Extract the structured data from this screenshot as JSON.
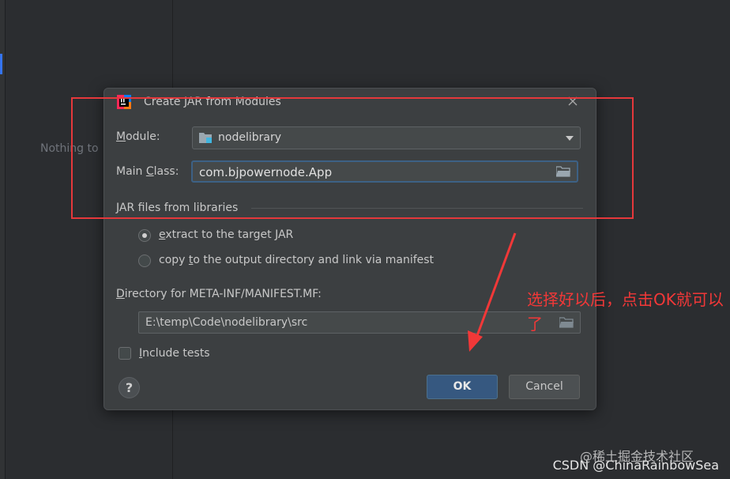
{
  "background": {
    "empty_text": "Nothing to"
  },
  "dialog": {
    "title": "Create JAR from Modules",
    "module_label_key": "M",
    "module_label_rest": "odule:",
    "module_value": "nodelibrary",
    "main_class_label_pre": "Main ",
    "main_class_label_key": "C",
    "main_class_label_post": "lass:",
    "main_class_value": "com.bjpowernode.App",
    "section_label": "JAR files from libraries",
    "radio_extract_key": "e",
    "radio_extract_rest": "xtract to the target JAR",
    "radio_copy_pre": "copy ",
    "radio_copy_key": "t",
    "radio_copy_rest": "o the output directory and link via manifest",
    "manifest_label_key": "D",
    "manifest_label_rest": "irectory for META-INF/MANIFEST.MF:",
    "manifest_value": "E:\\temp\\Code\\nodelibrary\\src",
    "include_tests_key": "I",
    "include_tests_rest": "nclude tests",
    "help_label": "?",
    "ok_label": "OK",
    "cancel_label": "Cancel"
  },
  "annotation": {
    "text": "选择好以后，点击OK就可以了"
  },
  "watermark": {
    "text": "CSDN @ChinaRainbowSea",
    "overlay": "@稀土掘金技术社区"
  },
  "colors": {
    "annotation_red": "#e5383b",
    "ok_blue": "#365880",
    "focus_blue": "#3d6185"
  }
}
